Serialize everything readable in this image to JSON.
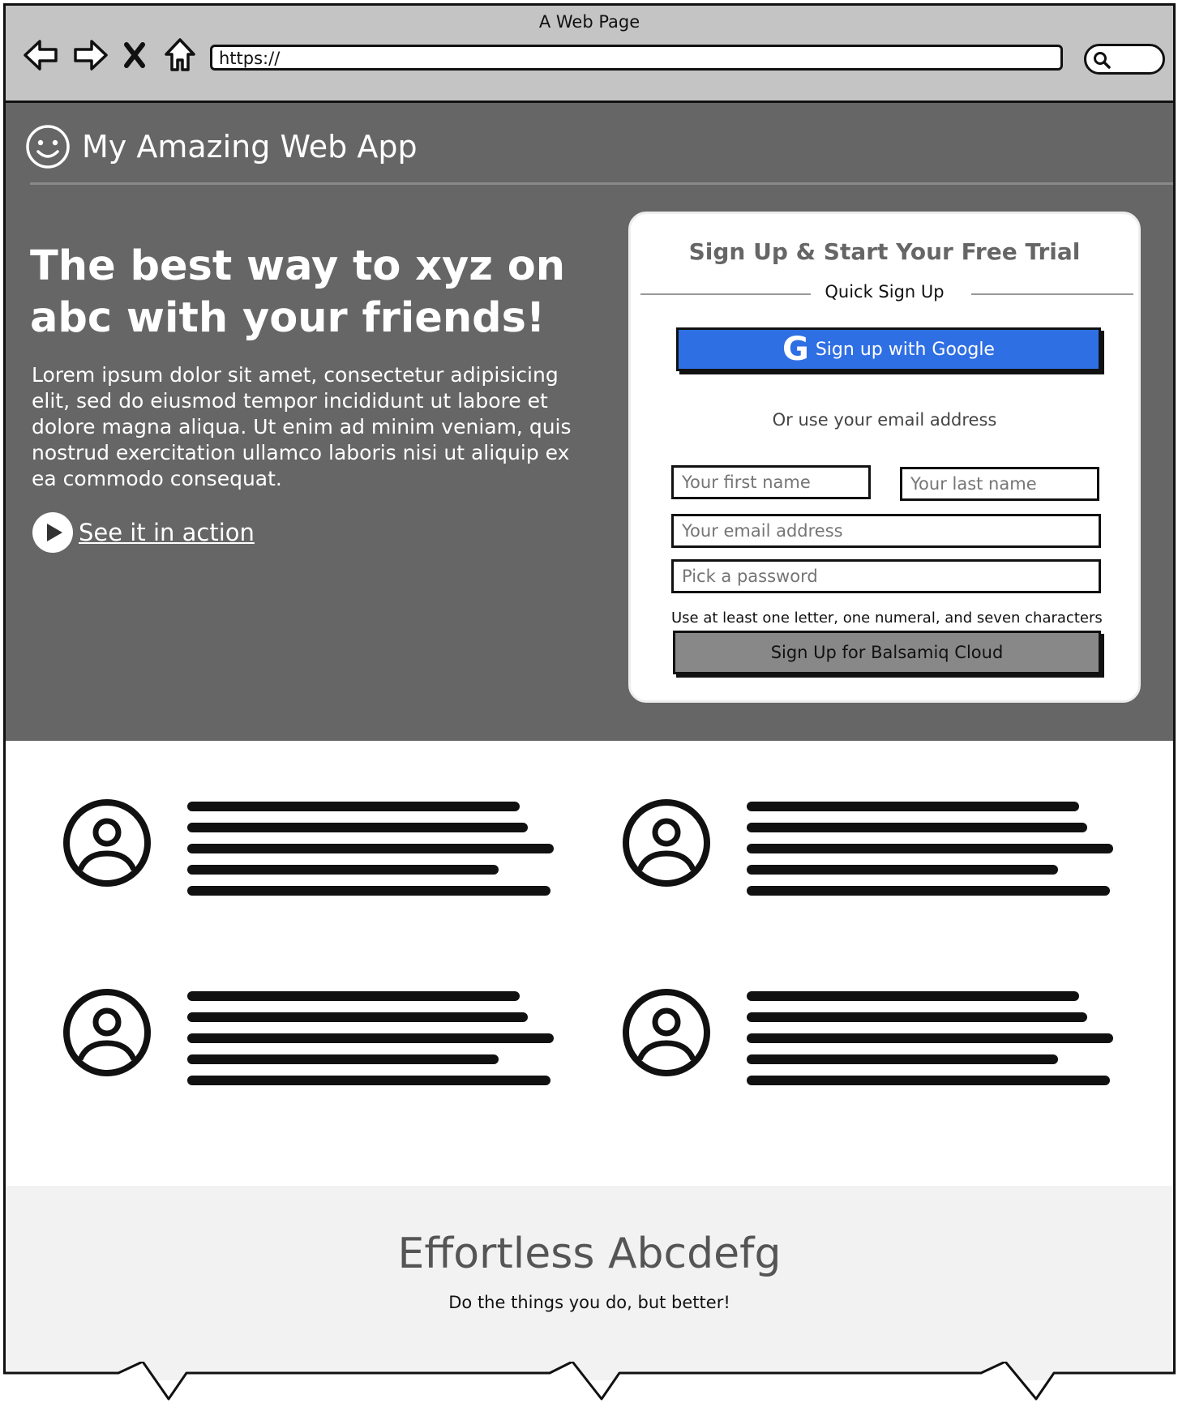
{
  "window": {
    "title": "A Web Page",
    "url": "https://"
  },
  "header": {
    "app_name": "My Amazing Web App"
  },
  "hero": {
    "headline": "The best way to xyz on abc with your friends!",
    "body": "Lorem ipsum dolor sit amet, consectetur adipisicing elit, sed do eiusmod tempor incididunt ut labore et dolore magna aliqua. Ut enim ad minim veniam, quis nostrud exercitation ullamco laboris nisi ut aliquip ex ea commodo consequat.",
    "action_label": "See it in action"
  },
  "signup": {
    "title": "Sign Up & Start Your Free Trial",
    "quick_label": "Quick Sign Up",
    "google_label": "Sign up with Google",
    "or_text": "Or use your email address",
    "first_name_placeholder": "Your first name",
    "last_name_placeholder": "Your last name",
    "email_placeholder": "Your email address",
    "password_placeholder": "Pick a password",
    "password_hint": "Use at least one letter, one numeral, and seven characters",
    "submit_label": "Sign Up for Balsamiq Cloud"
  },
  "footer": {
    "title": "Effortless Abcdefg",
    "subtitle": "Do the things you do, but better!"
  },
  "colors": {
    "hero_bg": "#666666",
    "google_blue": "#2f6fe4",
    "footer_bg": "#f2f2f2"
  }
}
